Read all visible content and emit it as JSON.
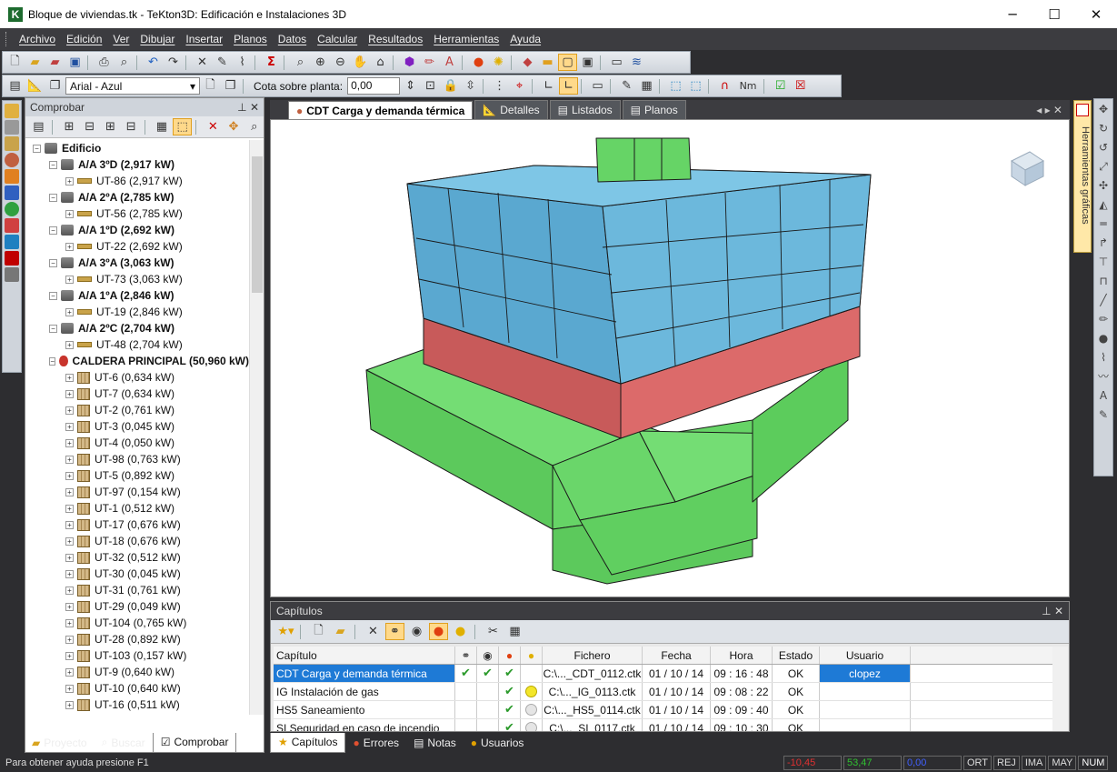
{
  "window": {
    "title": "Bloque de viviendas.tk - TeKton3D: Edificación e Instalaciones 3D",
    "logo": "K",
    "minimize": "─",
    "maximize": "☐",
    "close": "✕"
  },
  "menu": [
    "Archivo",
    "Edición",
    "Ver",
    "Dibujar",
    "Insertar",
    "Planos",
    "Datos",
    "Calcular",
    "Resultados",
    "Herramientas",
    "Ayuda"
  ],
  "toolbar2": {
    "font": "Arial - Azul",
    "cota_label": "Cota sobre planta:",
    "cota_value": "0,00",
    "nm_label": "Nm"
  },
  "comprobar": {
    "title": "Comprobar",
    "root": "Edificio",
    "groups": [
      {
        "label": "A/A 3ºD (2,917 kW)",
        "child": "UT-86 (2,917 kW)"
      },
      {
        "label": "A/A 2ºA (2,785 kW)",
        "child": "UT-56 (2,785 kW)"
      },
      {
        "label": "A/A 1ºD (2,692 kW)",
        "child": "UT-22 (2,692 kW)"
      },
      {
        "label": "A/A 3ºA (3,063 kW)",
        "child": "UT-73 (3,063 kW)"
      },
      {
        "label": "A/A 1ºA (2,846 kW)",
        "child": "UT-19 (2,846 kW)"
      },
      {
        "label": "A/A 2ºC (2,704 kW)",
        "child": "UT-48 (2,704 kW)"
      }
    ],
    "caldera": "CALDERA PRINCIPAL (50,960 kW)",
    "caldera_items": [
      "UT-6 (0,634 kW)",
      "UT-7 (0,634 kW)",
      "UT-2 (0,761 kW)",
      "UT-3 (0,045 kW)",
      "UT-4 (0,050 kW)",
      "UT-98 (0,763 kW)",
      "UT-5 (0,892 kW)",
      "UT-97 (0,154 kW)",
      "UT-1 (0,512 kW)",
      "UT-17 (0,676 kW)",
      "UT-18 (0,676 kW)",
      "UT-32 (0,512 kW)",
      "UT-30 (0,045 kW)",
      "UT-31 (0,761 kW)",
      "UT-29 (0,049 kW)",
      "UT-104 (0,765 kW)",
      "UT-28 (0,892 kW)",
      "UT-103 (0,157 kW)",
      "UT-9 (0,640 kW)",
      "UT-10 (0,640 kW)",
      "UT-16 (0,511 kW)"
    ]
  },
  "left_tabs": [
    "Proyecto",
    "Buscar",
    "Comprobar"
  ],
  "doc_tabs": [
    "CDT Carga y demanda térmica",
    "Detalles",
    "Listados",
    "Planos"
  ],
  "side_tab": "Herramientas gráficas",
  "capitulos": {
    "title": "Capítulos",
    "columns": [
      "Capítulo",
      "",
      "",
      "",
      "",
      "Fichero",
      "Fecha",
      "Hora",
      "Estado",
      "Usuario"
    ],
    "rows": [
      {
        "cap": "CDT Carga y demanda térmica",
        "c1": "✔",
        "c2": "✔",
        "c3": "✔",
        "c4": "",
        "fichero": "C:\\..._CDT_0112.ctk",
        "fecha": "01 / 10 / 14",
        "hora": "09 : 16 : 48",
        "estado": "OK",
        "usuario": "clopez"
      },
      {
        "cap": "IG Instalación de gas",
        "c1": "",
        "c2": "",
        "c3": "✔",
        "c4": "y",
        "fichero": "C:\\..._IG_0113.ctk",
        "fecha": "01 / 10 / 14",
        "hora": "09 : 08 : 22",
        "estado": "OK",
        "usuario": ""
      },
      {
        "cap": "HS5 Saneamiento",
        "c1": "",
        "c2": "",
        "c3": "✔",
        "c4": "g",
        "fichero": "C:\\..._HS5_0114.ctk",
        "fecha": "01 / 10 / 14",
        "hora": "09 : 09 : 40",
        "estado": "OK",
        "usuario": ""
      },
      {
        "cap": "SI Seguridad en caso de incendio",
        "c1": "",
        "c2": "",
        "c3": "✔",
        "c4": "g",
        "fichero": "C:\\..._SI_0117.ctk",
        "fecha": "01 / 10 / 14",
        "hora": "09 : 10 : 30",
        "estado": "OK",
        "usuario": ""
      }
    ]
  },
  "bottom_tabs": [
    "Capítulos",
    "Errores",
    "Notas",
    "Usuarios"
  ],
  "status": {
    "text": "Para obtener ayuda presione F1",
    "x": "-10,45",
    "y": "53,47",
    "z": "0,00",
    "flags": [
      "ORT",
      "REJ",
      "IMA",
      "MAY",
      "NUM"
    ]
  },
  "colors": {
    "blue_block": "#6cb8dc",
    "red_band": "#dc6464",
    "green_block": "#66d466",
    "selection": "#1e7ad6"
  }
}
